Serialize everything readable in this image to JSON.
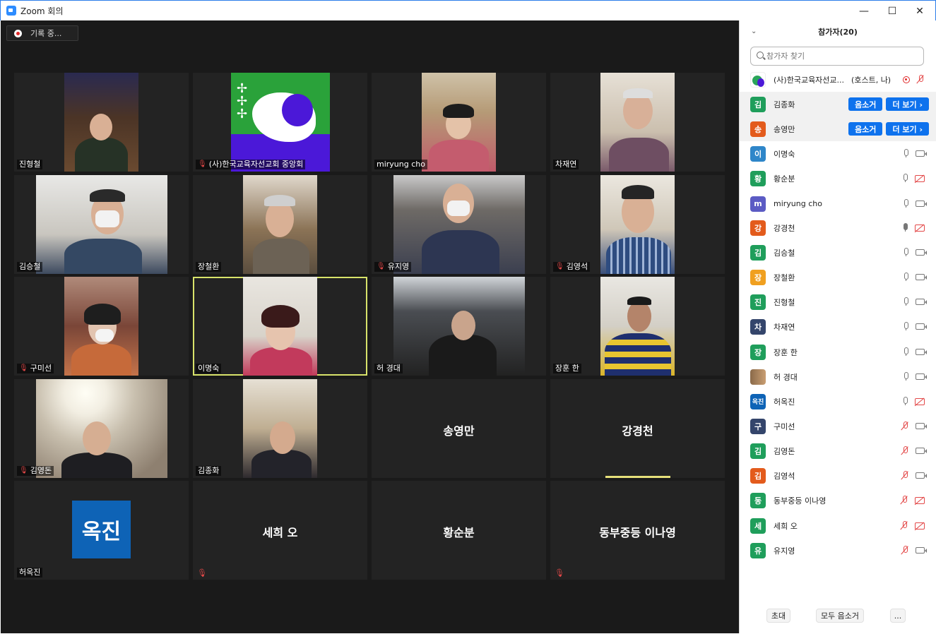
{
  "window": {
    "title": "Zoom 회의",
    "minimize": "—",
    "maximize": "☐",
    "close": "✕"
  },
  "meeting": {
    "recording_label": "기록 중...",
    "tiles": [
      {
        "name": "진형철",
        "muted": false
      },
      {
        "name": "(사)한국교육자선교회 중앙회",
        "muted": true
      },
      {
        "name": "miryung cho",
        "muted": false
      },
      {
        "name": "차재연",
        "muted": false
      },
      {
        "name": "김승철",
        "muted": false
      },
      {
        "name": "장철환",
        "muted": false
      },
      {
        "name": "유지영",
        "muted": true
      },
      {
        "name": "김영석",
        "muted": true
      },
      {
        "name": "구미선",
        "muted": true
      },
      {
        "name": "이명숙",
        "muted": false
      },
      {
        "name": "허 경대",
        "muted": false
      },
      {
        "name": "장훈 한",
        "muted": false
      },
      {
        "name": "김영돈",
        "muted": true
      },
      {
        "name": "김종화",
        "muted": false
      },
      {
        "name": "송영만",
        "muted": false
      },
      {
        "name": "강경천",
        "muted": false
      },
      {
        "name": "허옥진",
        "muted": false
      },
      {
        "name": "세희 오",
        "muted": true
      },
      {
        "name": "황순분",
        "muted": false
      },
      {
        "name": "동부중등 이나영",
        "muted": true
      }
    ],
    "okjin_avatar_text": "옥진"
  },
  "panel": {
    "title": "참가자(20)",
    "search_placeholder": "참가자 찾기",
    "mute_label": "음소거",
    "more_label": "더 보기 ›",
    "participants": [
      {
        "avatar": "",
        "name": "(사)한국교육자선교...",
        "extra": "(호스트, 나)",
        "color": "#2aa55a"
      },
      {
        "avatar": "김",
        "name": "김종화",
        "extra": "",
        "color": "#1f9e5b"
      },
      {
        "avatar": "송",
        "name": "송영만",
        "extra": "",
        "color": "#e35b1c"
      },
      {
        "avatar": "이",
        "name": "이명숙",
        "extra": "",
        "color": "#2e86c9"
      },
      {
        "avatar": "황",
        "name": "황순분",
        "extra": "",
        "color": "#1f9e5b"
      },
      {
        "avatar": "m",
        "name": "miryung cho",
        "extra": "",
        "color": "#5b5bc4"
      },
      {
        "avatar": "강",
        "name": "강경천",
        "extra": "",
        "color": "#e35b1c"
      },
      {
        "avatar": "김",
        "name": "김승철",
        "extra": "",
        "color": "#1f9e5b"
      },
      {
        "avatar": "장",
        "name": "장철환",
        "extra": "",
        "color": "#f0a020"
      },
      {
        "avatar": "진",
        "name": "진형철",
        "extra": "",
        "color": "#1f9e5b"
      },
      {
        "avatar": "차",
        "name": "차재연",
        "extra": "",
        "color": "#34456b"
      },
      {
        "avatar": "장",
        "name": "장훈 한",
        "extra": "",
        "color": "#1f9e5b"
      },
      {
        "avatar": "",
        "name": "허 경대",
        "extra": "",
        "color": "#8a6a4a"
      },
      {
        "avatar": "옥진",
        "name": "허옥진",
        "extra": "",
        "color": "#0e63b6"
      },
      {
        "avatar": "구",
        "name": "구미선",
        "extra": "",
        "color": "#34456b"
      },
      {
        "avatar": "김",
        "name": "김영돈",
        "extra": "",
        "color": "#1f9e5b"
      },
      {
        "avatar": "김",
        "name": "김영석",
        "extra": "",
        "color": "#e35b1c"
      },
      {
        "avatar": "동",
        "name": "동부중등 이나영",
        "extra": "",
        "color": "#1f9e5b"
      },
      {
        "avatar": "세",
        "name": "세희 오",
        "extra": "",
        "color": "#1f9e5b"
      },
      {
        "avatar": "유",
        "name": "유지영",
        "extra": "",
        "color": "#1f9e5b"
      }
    ],
    "invite_label": "초대",
    "mute_all_label": "모두 음소거",
    "more_options_label": "..."
  }
}
